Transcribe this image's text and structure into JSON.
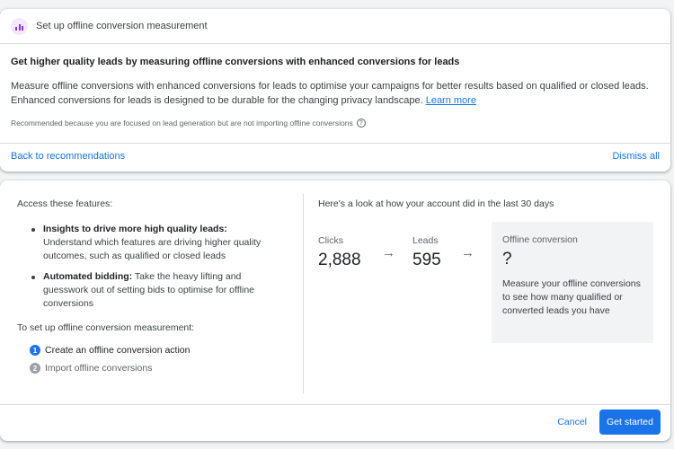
{
  "recommendation": {
    "header_title": "Set up offline conversion measurement",
    "headline": "Get higher quality leads by measuring offline conversions with enhanced conversions for leads",
    "description": "Measure offline conversions with enhanced conversions for leads to optimise your campaigns for better results based on qualified or closed leads. Enhanced conversions for leads is designed to be durable for the changing privacy landscape.",
    "learn_more": "Learn more",
    "reason": "Recommended because you are focused on lead generation but are not importing offline conversions",
    "back_link": "Back to recommendations",
    "dismiss_link": "Dismiss all",
    "icon": "bar-chart-icon",
    "icon_color": "#9334e6"
  },
  "features_panel": {
    "access_title": "Access these features:",
    "features": [
      {
        "bold": "Insights to drive more high quality leads:",
        "text": " Understand which features are driving higher quality outcomes, such as qualified or closed leads"
      },
      {
        "bold": "Automated bidding:",
        "text": " Take the heavy lifting and guesswork out of setting bids to optimise for offline conversions"
      }
    ],
    "setup_title": "To set up offline conversion measurement:",
    "steps": [
      {
        "num": "1",
        "label": "Create an offline conversion action"
      },
      {
        "num": "2",
        "label": "Import offline conversions"
      }
    ]
  },
  "performance": {
    "title": "Here's a look at how your account did in the last 30 days",
    "clicks_label": "Clicks",
    "clicks_value": "2,888",
    "leads_label": "Leads",
    "leads_value": "595",
    "offline_label": "Offline conversion",
    "offline_value": "?",
    "offline_desc": "Measure your offline conversions to see how many qualified or converted leads you have"
  },
  "footer": {
    "cancel_label": "Cancel",
    "start_label": "Get started"
  },
  "colors": {
    "accent": "#1a73e8",
    "step_inactive": "#9aa0a6"
  }
}
